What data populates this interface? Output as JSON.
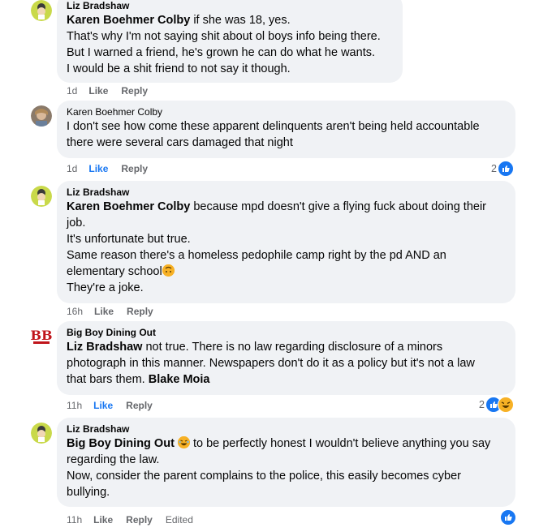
{
  "comments": [
    {
      "author": "Liz Bradshaw",
      "lines": [
        {
          "mention": "Karen Boehmer Colby",
          "text": " if she was 18, yes."
        },
        {
          "text": "That's why I'm not saying shit about ol boys info being there."
        },
        {
          "text": "But I warned a friend, he's grown he can do what he wants."
        },
        {
          "text": "I would be a shit friend to not say it though."
        }
      ],
      "time": "1d",
      "like": "Like",
      "reply": "Reply"
    },
    {
      "author": "Karen Boehmer Colby",
      "lines": [
        {
          "text": "I don't see how come these apparent delinquents aren't being held accountable"
        },
        {
          "text": "there were several cars damaged that night"
        }
      ],
      "time": "1d",
      "like": "Like",
      "reply": "Reply",
      "reaction_count": "2"
    },
    {
      "author": "Liz Bradshaw",
      "lines": [
        {
          "mention": "Karen Boehmer Colby",
          "text": " because mpd doesn't give a flying fuck about doing their"
        },
        {
          "text": "job."
        },
        {
          "text": "It's unfortunate but true."
        },
        {
          "text": "Same reason there's a homeless pedophile camp right by the pd AND an"
        },
        {
          "text": "elementary school",
          "emoji": "upside-down-face-emoji"
        },
        {
          "text": "They're a joke."
        }
      ],
      "time": "16h",
      "like": "Like",
      "reply": "Reply"
    },
    {
      "author": "Big Boy Dining Out",
      "lines": [
        {
          "mention": "Liz Bradshaw",
          "text": " not true. There is no law regarding disclosure of a minors"
        },
        {
          "text": "photograph in this manner. Newspapers don't do it as a policy but it's not a law"
        },
        {
          "text": "that bars them. ",
          "mention_end": "Blake Moia"
        }
      ],
      "time": "11h",
      "like": "Like",
      "reply": "Reply",
      "reaction_count": "2"
    },
    {
      "author": "Liz Bradshaw",
      "lines": [
        {
          "mention": "Big Boy Dining Out",
          "emoji_mid": "laughing-emoji",
          "text": " to be perfectly honest I wouldn't believe anything you say"
        },
        {
          "text": "regarding the law."
        },
        {
          "text": "Now, consider the parent complains to the police, this easily becomes cyber"
        },
        {
          "text": "bullying."
        }
      ],
      "time": "11h",
      "like": "Like",
      "reply": "Reply",
      "edited": "Edited"
    }
  ],
  "colors": {
    "bubble": "#f0f2f5",
    "link_blue": "#1877f2",
    "meta_gray": "#65676b"
  }
}
